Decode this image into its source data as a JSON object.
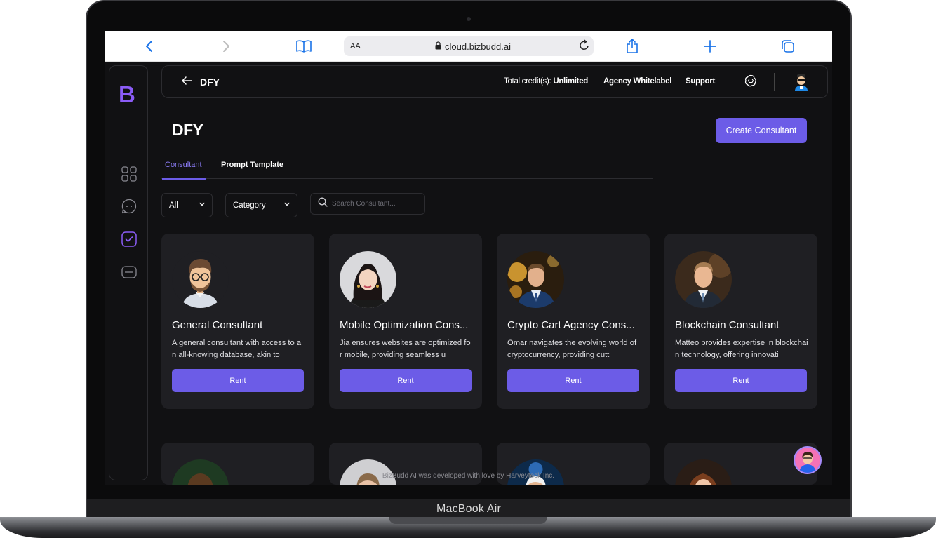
{
  "device": {
    "label": "MacBook Air"
  },
  "browser": {
    "text_size_label": "AA",
    "url": "cloud.bizbudd.ai"
  },
  "sidebar": {
    "logo": "B",
    "items": [
      {
        "icon": "grid-icon"
      },
      {
        "icon": "chat-icon"
      },
      {
        "icon": "checkbox-icon",
        "active": true
      },
      {
        "icon": "card-icon"
      }
    ]
  },
  "topbar": {
    "title": "DFY",
    "credits_label": "Total credit(s):",
    "credits_value": "Unlimited",
    "agency": "Agency Whitelabel",
    "support": "Support"
  },
  "page": {
    "title": "DFY",
    "create_button": "Create Consultant"
  },
  "tabs": [
    {
      "label": "Consultant",
      "active": true
    },
    {
      "label": "Prompt Template",
      "active": false
    }
  ],
  "filters": {
    "all": "All",
    "category": "Category",
    "search_placeholder": "Search Consultant..."
  },
  "consultants": [
    {
      "name": "General Consultant",
      "description": "A general consultant with access to an all-knowing database, akin to",
      "button": "Rent"
    },
    {
      "name": "Mobile Optimization Cons...",
      "description": "Jia ensures websites are optimized for mobile, providing seamless u",
      "button": "Rent"
    },
    {
      "name": "Crypto Cart Agency Cons...",
      "description": "Omar navigates the evolving world of cryptocurrency, providing cutt",
      "button": "Rent"
    },
    {
      "name": "Blockchain Consultant",
      "description": "Matteo provides expertise in blockchain technology, offering innovati",
      "button": "Rent"
    }
  ],
  "footer": {
    "text": "BizBudd AI was developed with love by Harveyteck Inc."
  },
  "colors": {
    "accent": "#6c5ce7",
    "logo": "#8b5cf6",
    "background": "#111113",
    "card": "#1f1f23"
  }
}
